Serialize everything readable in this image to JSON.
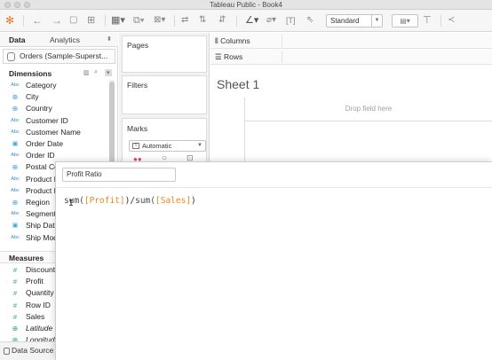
{
  "window": {
    "title": "Tableau Public - Book4"
  },
  "toolbar": {
    "view_select": "Standard"
  },
  "left_panel": {
    "tabs": [
      {
        "label": "Data"
      },
      {
        "label": "Analytics"
      }
    ],
    "data_source": "Orders (Sample-Superst...",
    "dimensions_label": "Dimensions",
    "dimensions": [
      {
        "type": "Abc",
        "name": "Category"
      },
      {
        "type": "globe",
        "name": "City"
      },
      {
        "type": "globe",
        "name": "Country"
      },
      {
        "type": "Abc",
        "name": "Customer ID"
      },
      {
        "type": "Abc",
        "name": "Customer Name"
      },
      {
        "type": "calendar",
        "name": "Order Date"
      },
      {
        "type": "Abc",
        "name": "Order ID"
      },
      {
        "type": "globe",
        "name": "Postal Co"
      },
      {
        "type": "Abc",
        "name": "Product I"
      },
      {
        "type": "Abc",
        "name": "Product N"
      },
      {
        "type": "globe",
        "name": "Region"
      },
      {
        "type": "Abc",
        "name": "Segment"
      },
      {
        "type": "calendar",
        "name": "Ship Date"
      },
      {
        "type": "Abc",
        "name": "Ship Mod"
      }
    ],
    "measures_label": "Measures",
    "measures": [
      {
        "type": "hash",
        "name": "Discount"
      },
      {
        "type": "hash",
        "name": "Profit"
      },
      {
        "type": "hash",
        "name": "Quantity"
      },
      {
        "type": "hash",
        "name": "Row ID"
      },
      {
        "type": "hash",
        "name": "Sales"
      },
      {
        "type": "globe",
        "name": "Latitude ("
      },
      {
        "type": "globe",
        "name": "Longitude"
      }
    ],
    "bottom_tab": "Data Source"
  },
  "cards": {
    "pages_label": "Pages",
    "filters_label": "Filters",
    "marks_label": "Marks",
    "marks_type": "Automatic"
  },
  "shelves": {
    "columns_label": "Columns",
    "rows_label": "Rows"
  },
  "sheet": {
    "title": "Sheet 1",
    "drop_hint": "Drop field here"
  },
  "calc_editor": {
    "name": "Profit Ratio",
    "formula": {
      "fn1": "sum(",
      "field1": "[Profit]",
      "mid": ")/",
      "fn2": "sum(",
      "field2": "[Sales]",
      "end": ")"
    }
  },
  "colors": {
    "accent_blue": "#3a8ec2",
    "measure_green": "#3aa57a",
    "field_orange": "#e08a2a"
  }
}
